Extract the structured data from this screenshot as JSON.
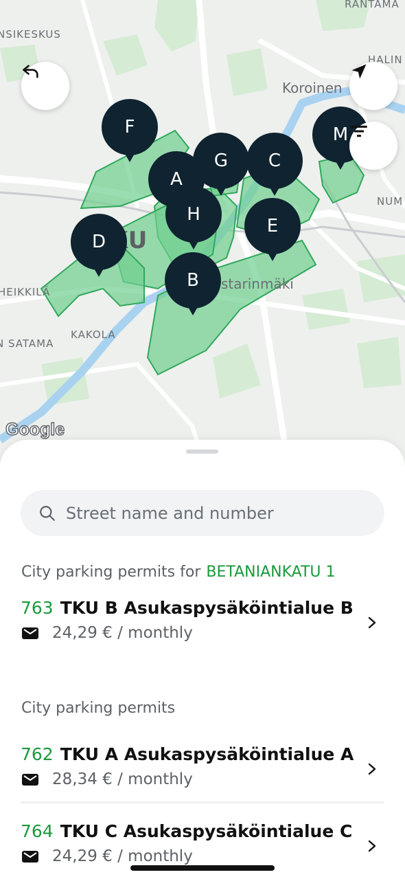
{
  "map": {
    "labels": {
      "rantama": "RANTAMA",
      "nsikeskus": "NSIKESKUS",
      "halin": "HALIN",
      "koroinen": "Koroinen",
      "num": "NUM",
      "tku": "KU",
      "starinmaki": "starinmäki",
      "heikkila": "HEIKKILÄ",
      "satama": "N SATAMA",
      "kakola": "KAKOLA"
    },
    "markers": {
      "F": "F",
      "A": "A",
      "G": "G",
      "C": "C",
      "M": "M",
      "H": "H",
      "E": "E",
      "D": "D",
      "B": "B"
    },
    "google_logo": "Google",
    "zone_color": "#6fcf8f",
    "marker_color": "#0f2330"
  },
  "buttons": {
    "back_icon": "undo-arrow-icon",
    "locate_icon": "navigation-arrow-icon",
    "filter_icon": "filter-icon"
  },
  "sheet": {
    "search": {
      "placeholder": "Street name and number",
      "value": ""
    },
    "nearby": {
      "title": "City parking permits for",
      "address": "BETANIANKATU 1",
      "items": [
        {
          "code": "763",
          "name": "TKU B Asukaspysäköintialue B",
          "price": "24,29 € / monthly"
        }
      ]
    },
    "all": {
      "title": "City parking permits",
      "items": [
        {
          "code": "762",
          "name": "TKU A Asukaspysäköintialue A",
          "price": "28,34 € / monthly"
        },
        {
          "code": "764",
          "name": "TKU C Asukaspysäköintialue C",
          "price": "24,29 € / monthly"
        }
      ]
    },
    "accent_color": "#1a9a3c"
  }
}
